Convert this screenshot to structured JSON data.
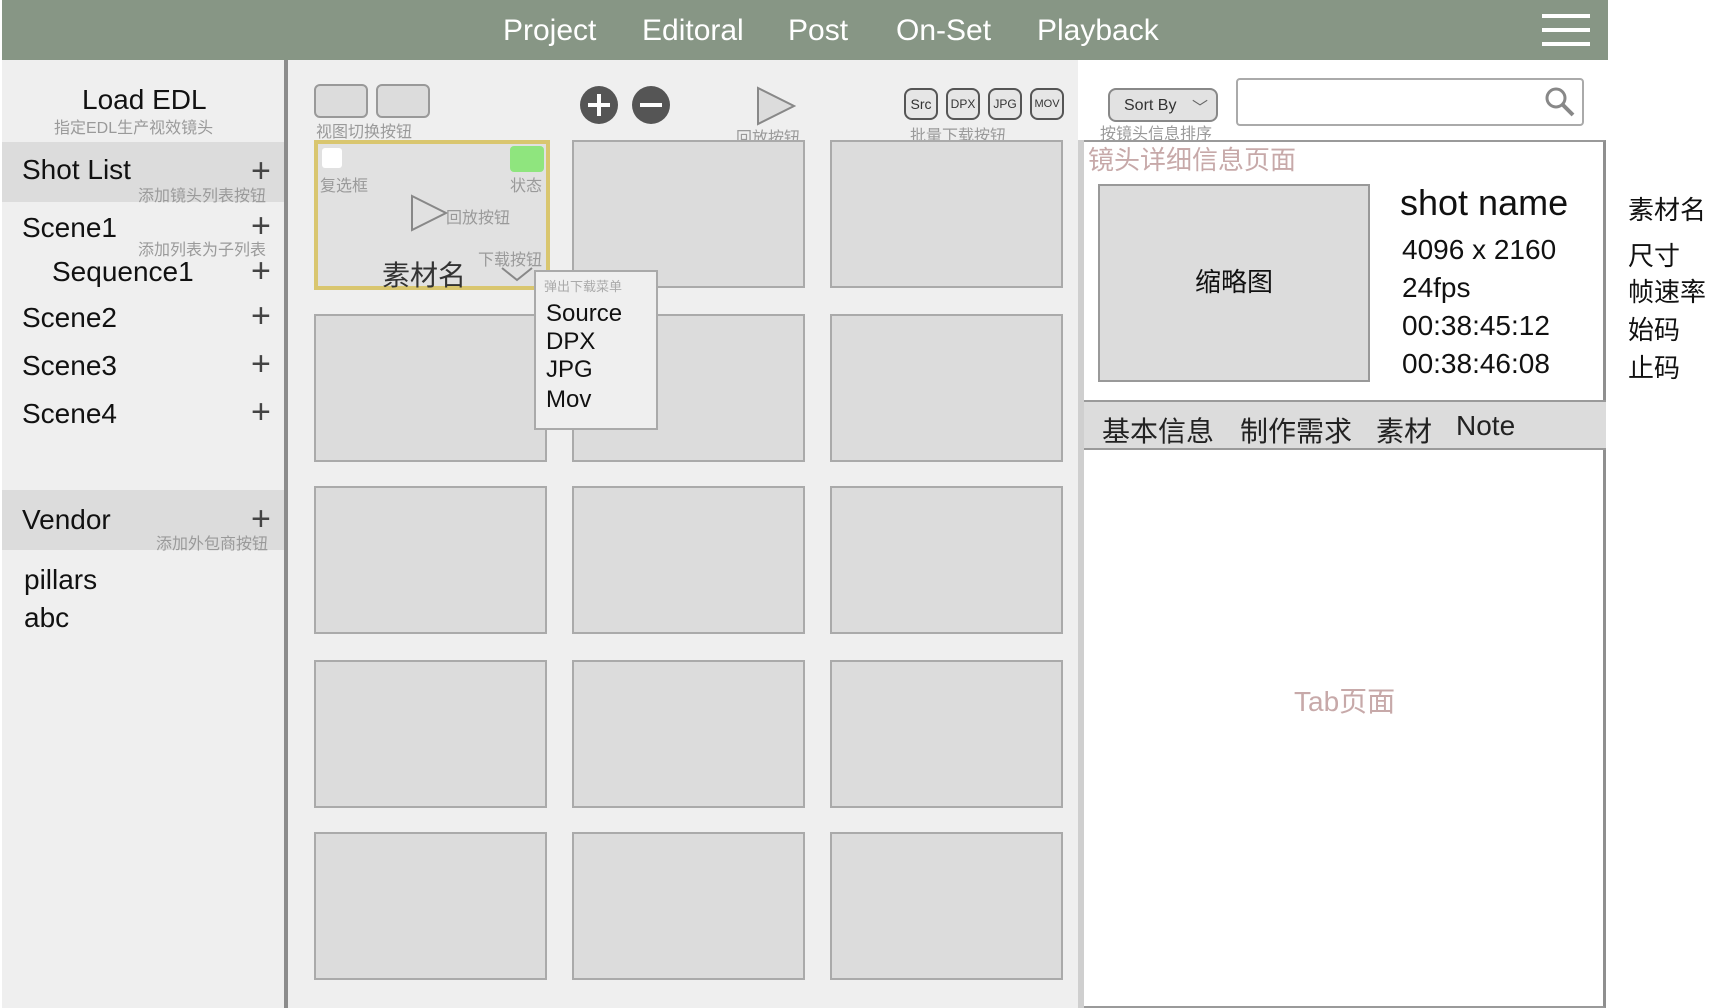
{
  "nav": {
    "items": [
      "Project",
      "Editoral",
      "Post",
      "On-Set",
      "Playback"
    ],
    "menu_icon": "hamburger-icon"
  },
  "sidebar": {
    "load_edl": "Load EDL",
    "load_edl_hint": "指定EDL生产视效镜头",
    "shot_list": "Shot List",
    "shot_list_hint": "添加镜头列表按钮",
    "sub_hint": "添加列表为子列表",
    "scenes": [
      "Scene1",
      "Sequence1",
      "Scene2",
      "Scene3",
      "Scene4"
    ],
    "vendor": "Vendor",
    "vendor_hint": "添加外包商按钮",
    "vendors": [
      "pillars",
      "abc"
    ]
  },
  "toolbar": {
    "view_switch_hint": "视图切换按钮",
    "playback_hint": "回放按钮",
    "batch_download_hint": "批量下载按钮",
    "formats": [
      "Src",
      "DPX",
      "JPG",
      "MOV"
    ],
    "sort_label": "Sort By",
    "sort_hint": "按镜头信息排序",
    "search_placeholder": ""
  },
  "tile": {
    "checkbox_hint": "复选框",
    "status_hint": "状态",
    "play_hint": "回放按钮",
    "download_hint": "下载按钮",
    "name": "素材名",
    "status_color": "#8fe57e",
    "selected_border": "#d9c66f"
  },
  "download_menu": {
    "title": "弹出下载菜单",
    "options": [
      "Source",
      "DPX",
      "JPG",
      "Mov"
    ]
  },
  "detail": {
    "title": "镜头详细信息页面",
    "thumbnail": "缩略图",
    "shot_name": "shot name",
    "resolution": "4096 x 2160",
    "fps": "24fps",
    "timecode_in": "00:38:45:12",
    "timecode_out": "00:38:46:08",
    "tabs": [
      "基本信息",
      "制作需求",
      "素材",
      "Note"
    ],
    "tab_page": "Tab页面"
  },
  "annotations": [
    "素材名",
    "尺寸",
    "帧速率",
    "始码",
    "止码"
  ],
  "colors": {
    "topbar": "#879685",
    "hint": "#9a9a9a",
    "title_hint": "#c7a9a9"
  }
}
